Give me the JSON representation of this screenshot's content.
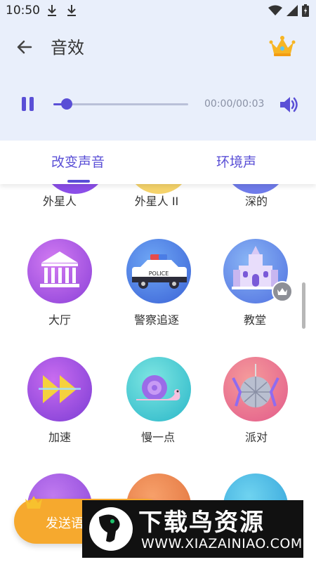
{
  "status_bar": {
    "time": "10:50",
    "icons": [
      "download-icon",
      "download-icon",
      "wifi-icon",
      "signal-icon",
      "battery-icon"
    ]
  },
  "app_bar": {
    "back_icon": "back-arrow-icon",
    "title": "音效",
    "vip_icon": "crown-icon"
  },
  "player": {
    "pause_icon": "pause-icon",
    "progress": 0.1,
    "time": "00:00/00:03",
    "volume_icon": "speaker-icon"
  },
  "tabs": [
    {
      "label": "改变声音",
      "selected": true
    },
    {
      "label": "环境声",
      "selected": false
    }
  ],
  "effects": [
    {
      "label": "外星人"
    },
    {
      "label": "外星人 II"
    },
    {
      "label": "深的"
    },
    {
      "label": "大厅",
      "icon": "hall-icon"
    },
    {
      "label": "警察追逐",
      "icon": "police-car-icon"
    },
    {
      "label": "教堂",
      "icon": "church-icon",
      "vip": true
    },
    {
      "label": "加速",
      "icon": "fast-forward-icon"
    },
    {
      "label": "慢一点",
      "icon": "snail-icon"
    },
    {
      "label": "派对",
      "icon": "disco-ball-icon"
    }
  ],
  "send_button": {
    "label": "发送语",
    "crown_icon": "crown-icon"
  },
  "watermark": {
    "title": "下载鸟资源",
    "url": "WWW.XIAZAINIAO.COM"
  },
  "colors": {
    "accent": "#5a4fd6",
    "header_bg": "#e9effb",
    "send_button": "#f6a92e"
  }
}
